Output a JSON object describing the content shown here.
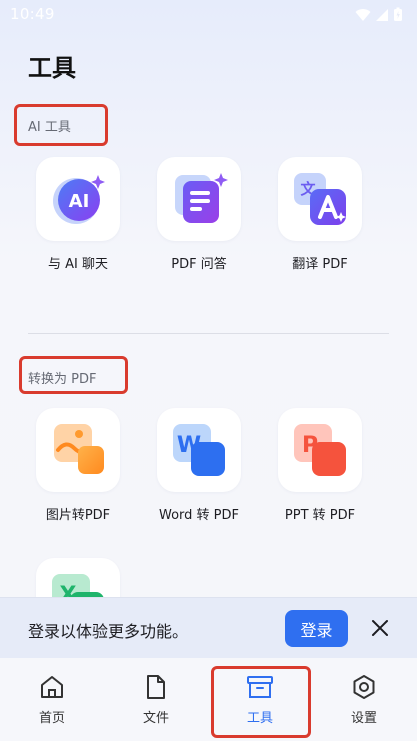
{
  "status_bar": {
    "time": "10:49"
  },
  "page": {
    "title": "工具"
  },
  "sections": {
    "ai": {
      "label": "AI 工具"
    },
    "convert": {
      "label": "转换为 PDF"
    }
  },
  "ai_tools": [
    {
      "label": "与 AI 聊天",
      "icon": "ai-chat-icon"
    },
    {
      "label": "PDF 问答",
      "icon": "pdf-qa-icon"
    },
    {
      "label": "翻译 PDF",
      "icon": "translate-icon"
    }
  ],
  "convert_tools": [
    {
      "label": "图片转PDF",
      "icon": "image-icon"
    },
    {
      "label": "Word 转 PDF",
      "icon": "word-icon"
    },
    {
      "label": "PPT 转 PDF",
      "icon": "ppt-icon"
    },
    {
      "label": "",
      "icon": "excel-icon"
    }
  ],
  "login_banner": {
    "text": "登录以体验更多功能。",
    "button": "登录"
  },
  "bottom_nav": {
    "items": [
      {
        "label": "首页",
        "icon": "home-icon"
      },
      {
        "label": "文件",
        "icon": "file-icon"
      },
      {
        "label": "工具",
        "icon": "toolbox-icon",
        "active": true
      },
      {
        "label": "设置",
        "icon": "settings-icon"
      }
    ]
  },
  "colors": {
    "accent": "#2f6ff0",
    "highlight": "#d93b2e"
  }
}
